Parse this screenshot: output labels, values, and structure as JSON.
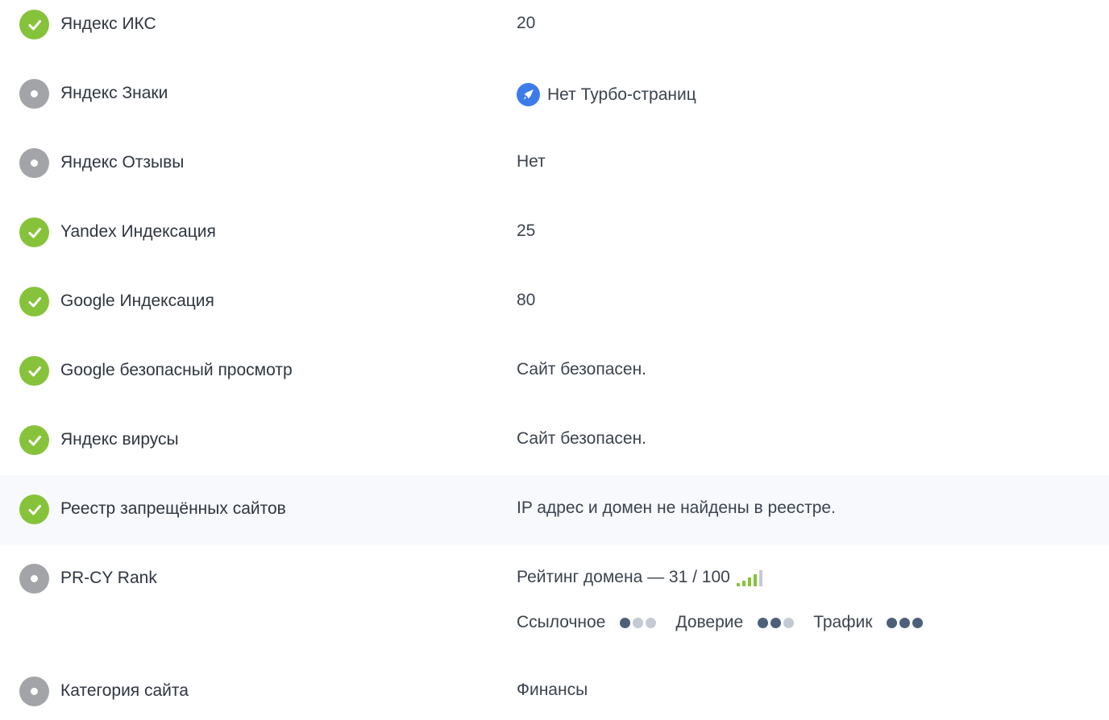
{
  "rows": [
    {
      "label": "Яндекс ИКС",
      "value": "20",
      "status": "ok"
    },
    {
      "label": "Яндекс Знаки",
      "value": "Нет Турбо-страниц",
      "status": "na",
      "icon": "rocket-icon"
    },
    {
      "label": "Яндекс Отзывы",
      "value": "Нет",
      "status": "na"
    },
    {
      "label": "Yandex Индексация",
      "value": "25",
      "status": "ok"
    },
    {
      "label": "Google Индексация",
      "value": "80",
      "status": "ok"
    },
    {
      "label": "Google безопасный просмотр",
      "value": "Сайт безопасен.",
      "status": "ok"
    },
    {
      "label": "Яндекс вирусы",
      "value": "Сайт безопасен.",
      "status": "ok"
    },
    {
      "label": "Реестр запрещённых сайтов",
      "value": "IP адрес и домен не найдены в реестре.",
      "status": "ok",
      "highlighted": true
    },
    {
      "label": "PR-CY Rank",
      "value": "Рейтинг домена — 31 / 100",
      "status": "na"
    },
    {
      "label": "Категория сайта",
      "value": "Финансы",
      "status": "na"
    }
  ],
  "prcy": {
    "signal_level": 4,
    "signal_total": 5,
    "metrics": [
      {
        "label": "Ссылочное",
        "level": 1,
        "max": 3
      },
      {
        "label": "Доверие",
        "level": 2,
        "max": 3
      },
      {
        "label": "Трафик",
        "level": 3,
        "max": 3
      }
    ]
  },
  "colors": {
    "ok": "#87c33a",
    "na": "#a2a4a7",
    "turbo": "#3d7bea",
    "signal_on": "#87c33a",
    "signal_off": "#c4cad3",
    "dot_on": "#4c6079",
    "dot_off": "#c4cad3",
    "highlight": "#f7f9fc"
  }
}
